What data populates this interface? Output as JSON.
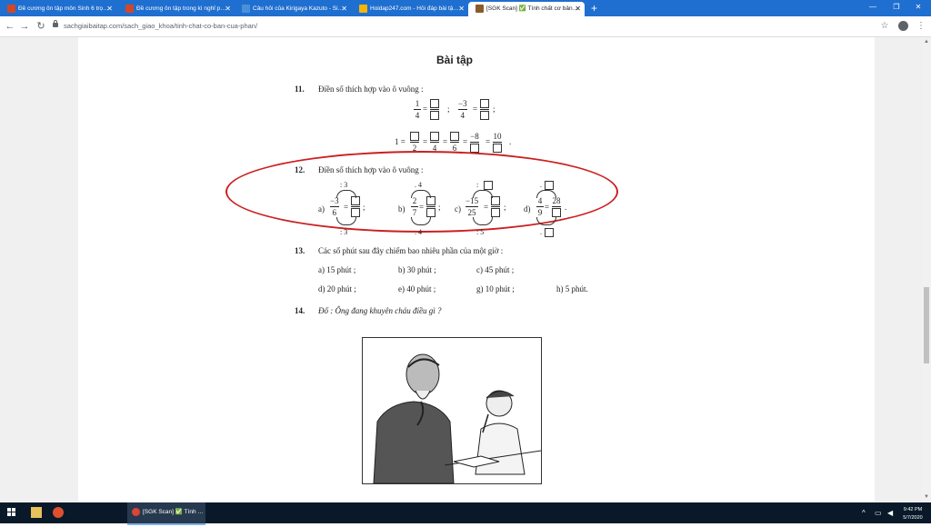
{
  "browser": {
    "tabs": [
      {
        "label": "Đề cương ôn tập môn Sinh 6 trọ…",
        "icon": "powerpoint-icon",
        "color": "#d24726"
      },
      {
        "label": "Đề cương ôn tập trong kì nghỉ p…",
        "icon": "powerpoint-icon",
        "color": "#d24726"
      },
      {
        "label": "Câu hỏi của Kirigaya Kazuto - Si…",
        "icon": "page-icon",
        "color": "#4a90d9"
      },
      {
        "label": "Hoidap247.com - Hỏi đáp bài tậ…",
        "icon": "hoidap-icon",
        "color": "#f5b50a"
      },
      {
        "label": "[SGK Scan] ✅ Tính chất cơ bản…",
        "icon": "sgk-icon",
        "color": "#8a5a2b"
      }
    ],
    "new_tab": "+",
    "url": "sachgiaibaitap.com/sach_giao_khoa/tinh-chat-co-ban-cua-phan/"
  },
  "scan": {
    "heading": "Bài tập",
    "q11": {
      "num": "11.",
      "text": "Điền số thích hợp vào ô vuông :"
    },
    "q12": {
      "num": "12.",
      "text": "Điền số thích hợp vào ô vuông :"
    },
    "q12_items": {
      "a": {
        "label": "a)",
        "num": "−3",
        "den": "6",
        "top_op": ": 3",
        "bot_op": ": 3"
      },
      "b": {
        "label": "b)",
        "num": "2",
        "den": "7",
        "top_op": ". 4",
        "bot_op": ". 4"
      },
      "c": {
        "label": "c)",
        "num": "−15",
        "den": "25",
        "top_op": ":",
        "bot_op": ": 5",
        "rnum": ""
      },
      "d": {
        "label": "d)",
        "num": "4",
        "den": "9",
        "top_op": ".",
        "bot_op": ".",
        "rnum": "28"
      }
    },
    "q13": {
      "num": "13.",
      "text": "Các số phút sau đây chiếm bao nhiêu phần của một giờ :",
      "answers": [
        "a) 15 phút   ;",
        "b) 30 phút   ;",
        "c) 45 phút   ;",
        "d) 20 phút   ;",
        "e) 40 phút   ;",
        "g) 10 phút   ;",
        "h) 5 phút."
      ]
    },
    "q14": {
      "num": "14.",
      "text": "Đố : Ông đang khuyên cháu điều gì ?"
    },
    "q11_line1": {
      "n1": "1",
      "d1": "4",
      "n2": "−3",
      "d2": "4"
    },
    "q11_line2": {
      "lead": "1 =",
      "d1": "2",
      "d2": "4",
      "d3": "6",
      "n4": "−8",
      "n5": "10"
    }
  },
  "taskbar": {
    "app_label": "[SGK Scan] ✅ Tính …",
    "time": "9:42 PM",
    "date": "5/7/2020"
  },
  "colors": {
    "tabstrip": "#1f6fd0",
    "annotation": "#cc1f1f",
    "taskbar": "#0a1929"
  }
}
